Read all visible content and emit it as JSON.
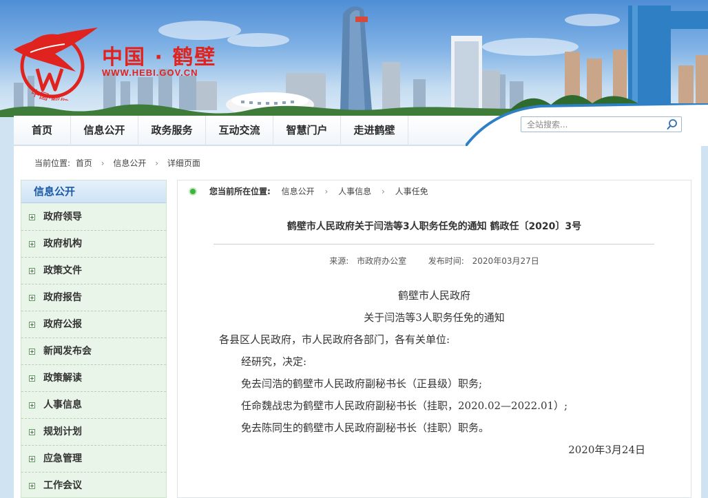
{
  "site": {
    "logo_cn": "中国 · 鹤壁",
    "logo_url": "WWW.HEBI.GOV.CN",
    "logo_ring_text": "中国·鹤壁"
  },
  "nav": {
    "items": [
      {
        "label": "首页"
      },
      {
        "label": "信息公开"
      },
      {
        "label": "政务服务"
      },
      {
        "label": "互动交流"
      },
      {
        "label": "智慧门户"
      },
      {
        "label": "走进鹤壁"
      }
    ],
    "search_placeholder": "全站搜索..."
  },
  "breadcrumb_top": {
    "prefix": "当前位置:",
    "items": [
      "首页",
      "信息公开",
      "详细页面"
    ]
  },
  "sidebar": {
    "title": "信息公开",
    "items": [
      {
        "label": "政府领导"
      },
      {
        "label": "政府机构"
      },
      {
        "label": "政策文件"
      },
      {
        "label": "政府报告"
      },
      {
        "label": "政府公报"
      },
      {
        "label": "新闻发布会"
      },
      {
        "label": "政策解读"
      },
      {
        "label": "人事信息"
      },
      {
        "label": "规划计划"
      },
      {
        "label": "应急管理"
      },
      {
        "label": "工作会议"
      }
    ]
  },
  "location": {
    "label": "您当前所在位置:",
    "items": [
      "信息公开",
      "人事信息",
      "人事任免"
    ]
  },
  "article": {
    "title": "鹤壁市人民政府关于闫浩等3人职务任免的通知 鹤政任〔2020〕3号",
    "source_label": "来源:",
    "source": "市政府办公室",
    "date_label": "发布时间:",
    "date": "2020年03月27日",
    "body": {
      "org": "鹤壁市人民政府",
      "heading": "关于闫浩等3人职务任免的通知",
      "salutation": "各县区人民政府，市人民政府各部门，各有关单位:",
      "p1": "经研究，决定:",
      "p2": "免去闫浩的鹤壁市人民政府副秘书长（正县级）职务;",
      "p3": "任命魏战忠为鹤壁市人民政府副秘书长（挂职，2020.02—2022.01）;",
      "p4": "免去陈同生的鹤壁市人民政府副秘书长（挂职）职务。",
      "signdate": "2020年3月24日"
    }
  },
  "colors": {
    "nav_text": "#2b2b2b",
    "sidebar_head_text": "#1a5aa5",
    "logo_red": "#e0231f",
    "sidebar_bg": "#eaf5ea"
  },
  "icons": {
    "search": "magnifier-icon",
    "sidebar_item": "plus-box-icon",
    "location": "green-dot-icon"
  }
}
